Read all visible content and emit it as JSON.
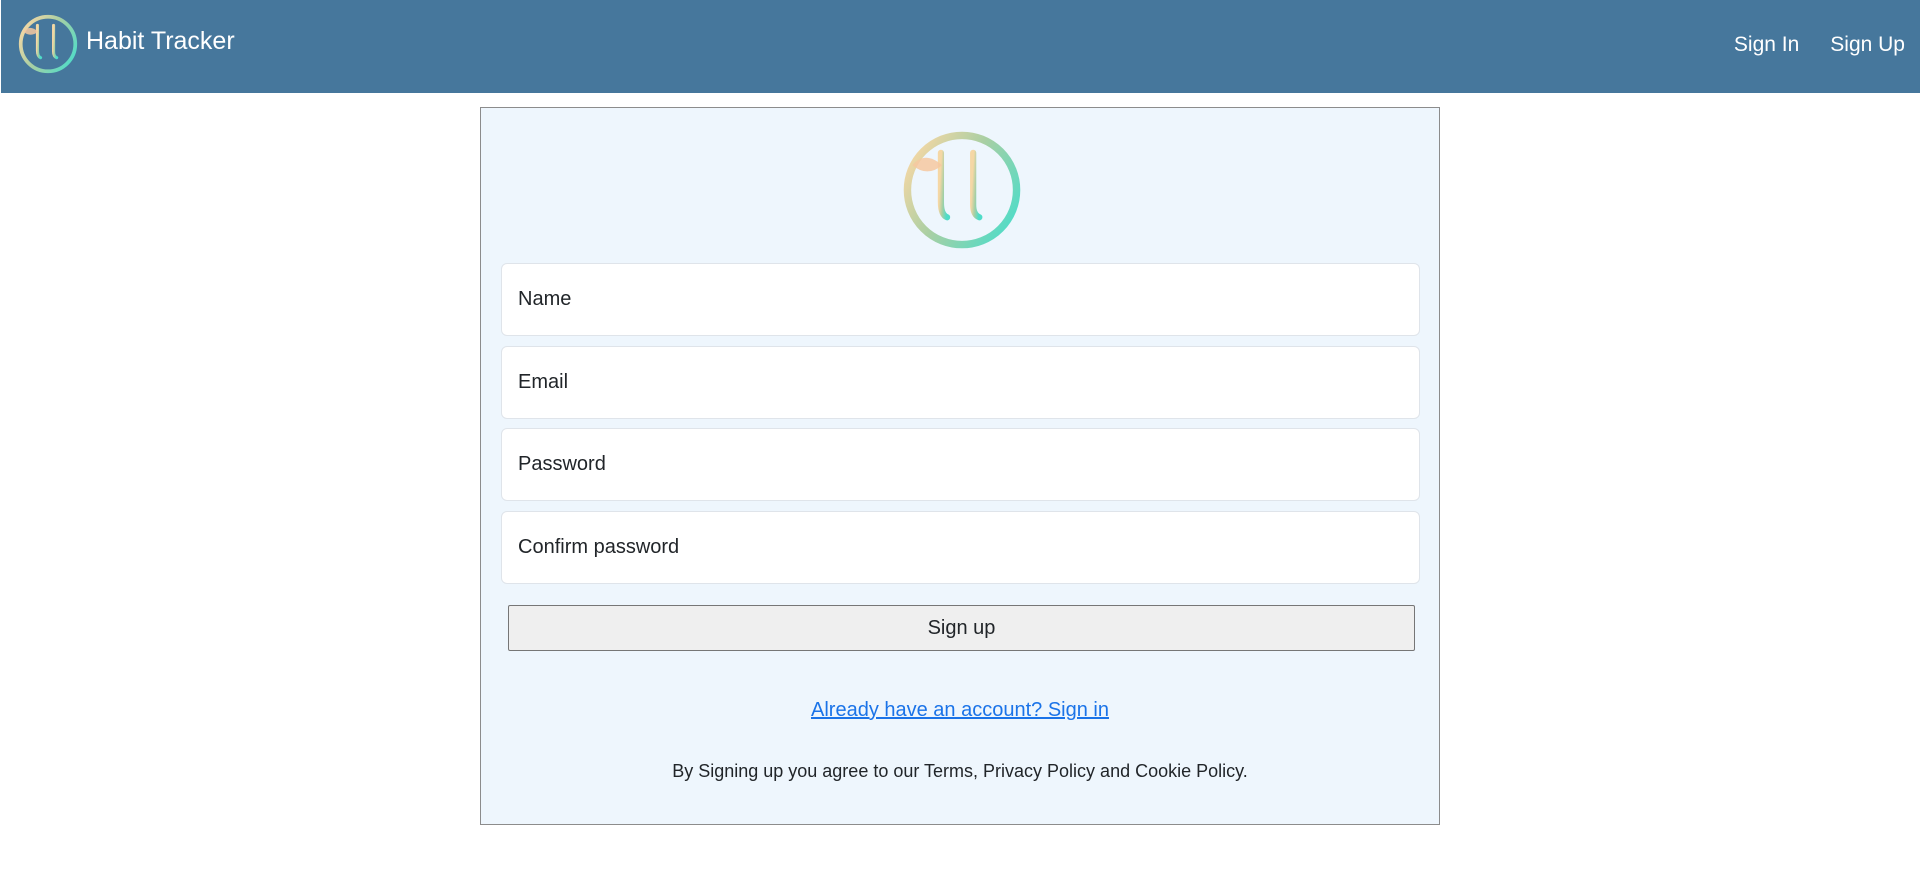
{
  "navbar": {
    "brand_text": "Habit Tracker",
    "brand_logo_icon": "habit-tracker-logo-icon",
    "links": [
      {
        "label": "Sign In"
      },
      {
        "label": "Sign Up"
      }
    ],
    "background_color": "#46779c"
  },
  "signup_card": {
    "logo_icon": "habit-tracker-logo-icon",
    "fields": {
      "name_placeholder": "Name",
      "email_placeholder": "Email",
      "password_placeholder": "Password",
      "confirm_password_placeholder": "Confirm password"
    },
    "submit_label": "Sign up",
    "signin_link_text": "Already have an account? Sign in",
    "terms_text": "By Signing up you agree to our Terms, Privacy Policy and Cookie Policy.",
    "background_color": "#eef6fd",
    "link_color": "#1a73e8"
  }
}
